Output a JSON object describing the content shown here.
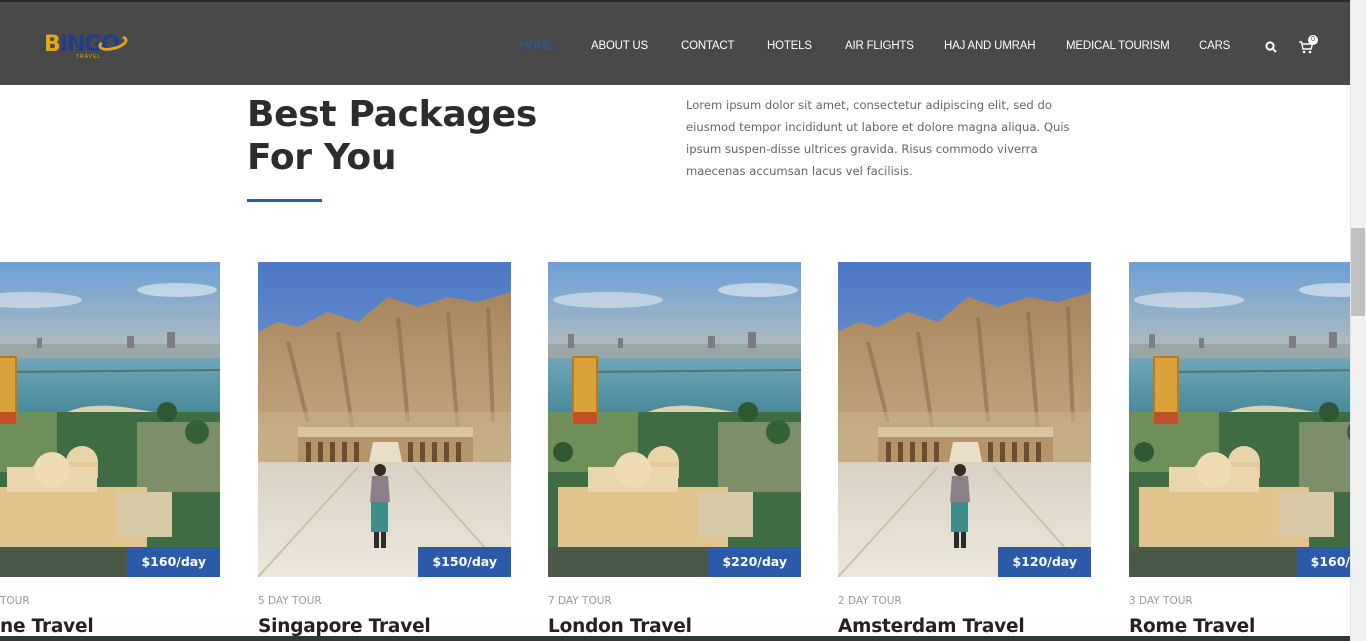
{
  "brand": {
    "logo_text_main": "INGO",
    "logo_text_b": "B",
    "logo_sub": "TRAVEL"
  },
  "nav": {
    "items": [
      {
        "label": "HOME",
        "active": true
      },
      {
        "label": "ABOUT US"
      },
      {
        "label": "CONTACT"
      },
      {
        "label": "HOTELS"
      },
      {
        "label": "AIR FLIGHTS"
      },
      {
        "label": "HAJ AND UMRAH"
      },
      {
        "label": "MEDICAL TOURISM"
      },
      {
        "label": "CARS"
      }
    ],
    "search_icon": "search-icon",
    "cart_icon": "cart-icon",
    "cart_count": "0"
  },
  "section": {
    "title_line1": "Best Packages",
    "title_line2": "For You",
    "description": "Lorem ipsum dolor sit amet, consectetur adipiscing elit, sed do eiusmod tempor incididunt ut labore et dolore magna aliqua. Quis ipsum suspen-disse ultrices gravida. Risus commodo viverra maecenas accumsan lacus vel facilisis."
  },
  "packages": [
    {
      "duration": "TOUR",
      "title": "ne Travel",
      "price": "$160/day",
      "image": "cairo-nile-city"
    },
    {
      "duration": "5 DAY TOUR",
      "title": "Singapore Travel",
      "price": "$150/day",
      "image": "hatshepsut-temple"
    },
    {
      "duration": "7 DAY TOUR",
      "title": "London Travel",
      "price": "$220/day",
      "image": "cairo-nile-city"
    },
    {
      "duration": "2 DAY TOUR",
      "title": "Amsterdam Travel",
      "price": "$120/day",
      "image": "hatshepsut-temple"
    },
    {
      "duration": "3 DAY TOUR",
      "title": "Rome Travel",
      "price": "$160/",
      "image": "cairo-nile-city"
    }
  ],
  "colors": {
    "header_bg": "#494949",
    "accent": "#2b5aa8",
    "price_bg": "#2b5aa8"
  }
}
